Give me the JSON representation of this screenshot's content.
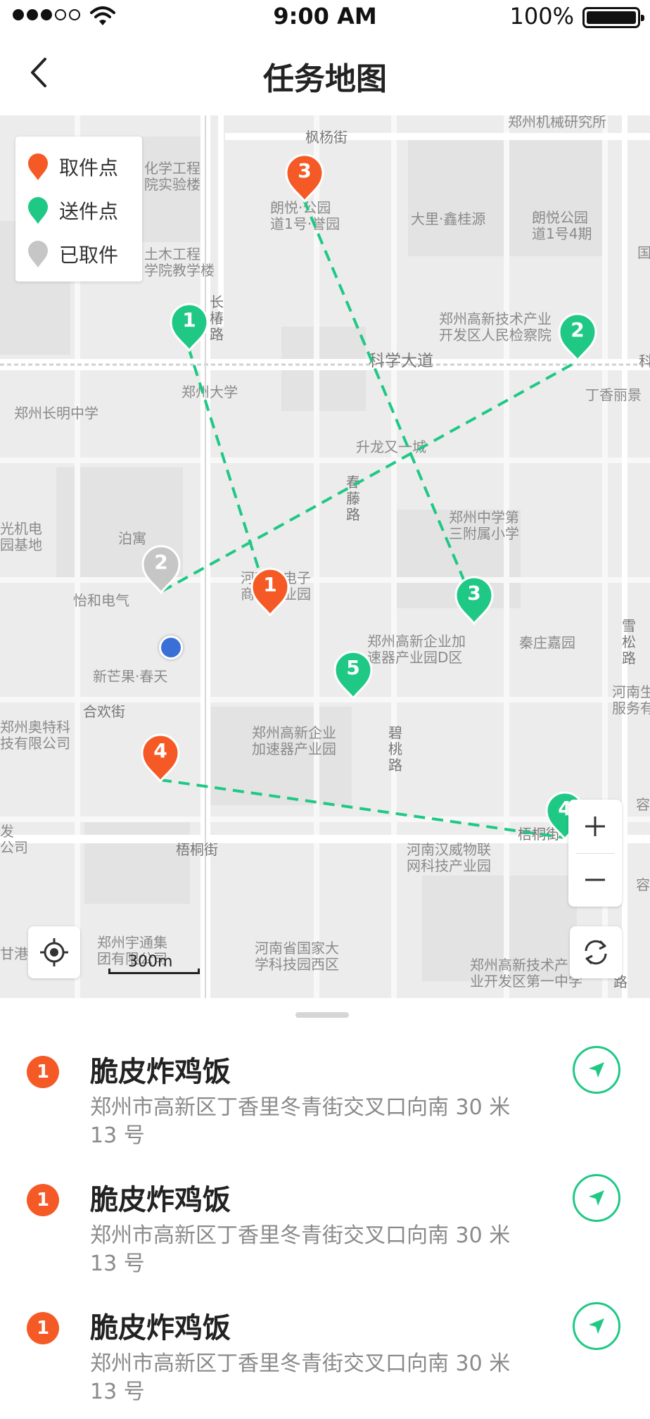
{
  "status_bar": {
    "time": "9:00 AM",
    "battery": "100%"
  },
  "header": {
    "title": "任务地图"
  },
  "legend": [
    {
      "label": "取件点",
      "color": "#f55a26"
    },
    {
      "label": "送件点",
      "color": "#1fc985"
    },
    {
      "label": "已取件",
      "color": "#c6c6c6"
    }
  ],
  "markers": {
    "pickup": [
      "3",
      "1",
      "4"
    ],
    "delivery": [
      "1",
      "2",
      "3",
      "5",
      "4"
    ],
    "picked": [
      "2"
    ]
  },
  "map_labels": [
    "郑州机械研究所",
    "枫杨街",
    "化学工程\n院实验楼",
    "朗悦·公园\n道1号·誉园",
    "大里·鑫桂源",
    "朗悦公园\n道1号4期",
    "国",
    "土木工程\n学院教学楼",
    "长\n椿\n路",
    "郑州高新技术产业\n开发区人民检察院",
    "科学大道",
    "科",
    "郑州大学",
    "丁香丽景",
    "郑州长明中学",
    "升龙又一城",
    "春\n藤\n路",
    "光机电\n园基地",
    "泊寓",
    "郑州中学第\n三附属小学",
    "河南省电子\n商务产业园",
    "怡和电气",
    "郑州高新企业加\n速器产业园D区",
    "秦庄嘉园",
    "雪\n松\n路",
    "新芒果·春天",
    "河南生\n服务有",
    "合欢街",
    "郑州奥特科\n技有限公司",
    "郑州高新企业\n加速器产业园",
    "碧\n桃\n路",
    "梧桐街",
    "梧桐街",
    "河南汉威物联\n网科技产业园",
    "容",
    "发\n公司",
    "郑州宇通集\n团有限公司",
    "河南省国家大\n学科技园西区",
    "郑州高新技术产\n业开发区第一中学",
    "容",
    "甘港",
    "路"
  ],
  "scale": "300m",
  "tasks": [
    {
      "badge": "1",
      "name": "脆皮炸鸡饭",
      "address": "郑州市高新区丁香里冬青街交叉口向南 30 米 13 号"
    },
    {
      "badge": "1",
      "name": "脆皮炸鸡饭",
      "address": "郑州市高新区丁香里冬青街交叉口向南 30 米 13 号"
    },
    {
      "badge": "1",
      "name": "脆皮炸鸡饭",
      "address": "郑州市高新区丁香里冬青街交叉口向南 30 米 13 号"
    }
  ]
}
